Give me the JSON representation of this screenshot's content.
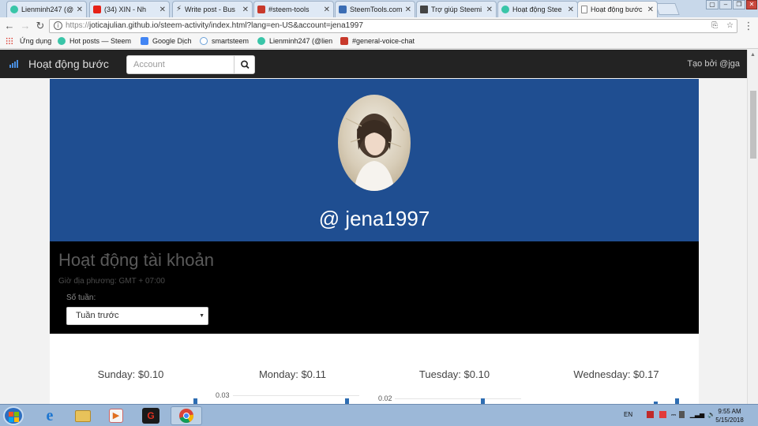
{
  "browser": {
    "tabs": [
      {
        "label": "Lienminh247 (@",
        "icon_color": "#39c5a8"
      },
      {
        "label": "(34) XIN - Nh",
        "icon_color": "#e62117"
      },
      {
        "label": "Write post - Bus",
        "icon_color": "#333333"
      },
      {
        "label": "#steem-tools",
        "icon_color": "#c8392b"
      },
      {
        "label": "SteemTools.com",
        "icon_color": "#3b6db4"
      },
      {
        "label": "Trợ giúp Steemi",
        "icon_color": "#444444"
      },
      {
        "label": "Hoạt động Stee",
        "icon_color": "#39c5a8"
      },
      {
        "label": "Hoạt động bước",
        "icon_color": "#888888"
      }
    ],
    "url_scheme": "https://",
    "url_rest": "joticajulian.github.io/steem-activity/index.html?lang=en-US&account=jena1997",
    "bookmarks": [
      {
        "label": "Ứng dụng",
        "icon_color": "#d93025"
      },
      {
        "label": "Hot posts — Steem",
        "icon_color": "#39c5a8"
      },
      {
        "label": "Google Dịch",
        "icon_color": "#4285f4"
      },
      {
        "label": "smartsteem",
        "icon_color": "#6aa0d8"
      },
      {
        "label": "Lienminh247 (@lien",
        "icon_color": "#39c5a8"
      },
      {
        "label": "#general-voice-chat",
        "icon_color": "#c8392b"
      }
    ]
  },
  "app": {
    "brand": "Hoạt động bước",
    "search_placeholder": "Account",
    "author": "Tạo bởi @jga",
    "username": "@ jena1997",
    "activity_title": "Hoạt động tài khoản",
    "timezone": "Giờ địa phương: GMT + 07:00",
    "weeks_label": "Số tuần:",
    "weeks_value": "Tuần trước",
    "accent_color": "#1f4e91"
  },
  "days": [
    {
      "label": "Sunday: $0.10"
    },
    {
      "label": "Monday: $0.11",
      "tick": "0.03"
    },
    {
      "label": "Tuesday: $0.10",
      "tick": "0.02"
    },
    {
      "label": "Wednesday: $0.17"
    }
  ],
  "taskbar": {
    "lang": "EN",
    "time": "9:55 AM",
    "date": "5/15/2018"
  }
}
